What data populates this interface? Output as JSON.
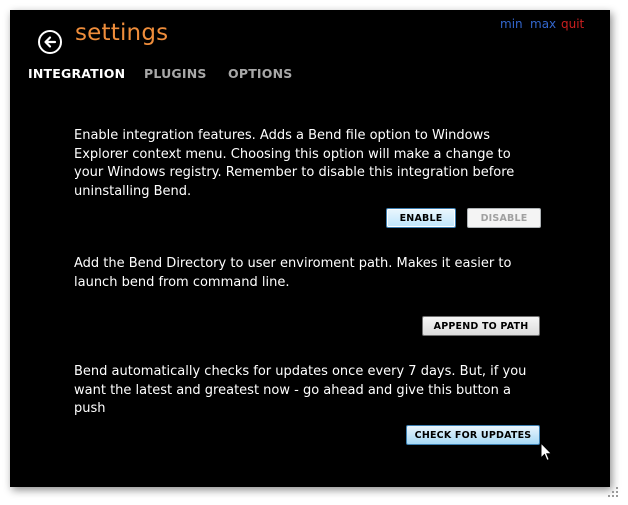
{
  "header": {
    "title": "settings",
    "back_icon": "back-arrow-icon"
  },
  "window_controls": {
    "min": "min",
    "max": "max",
    "quit": "quit"
  },
  "tabs": [
    {
      "label": "INTEGRATION",
      "active": true
    },
    {
      "label": "PLUGINS",
      "active": false
    },
    {
      "label": "OPTIONS",
      "active": false
    }
  ],
  "sections": {
    "integration": {
      "text": "Enable integration features. Adds a Bend file option to Windows Explorer context menu. Choosing this option will make a change to your Windows registry. Remember to disable this integration before uninstalling Bend.",
      "enable_label": "ENABLE",
      "disable_label": "DISABLE"
    },
    "path": {
      "text": "Add the Bend Directory to user enviroment path. Makes it easier to launch bend from command line.",
      "button_label": "APPEND TO PATH"
    },
    "updates": {
      "text": "Bend automatically checks for updates once every 7 days. But, if you want the latest and greatest now - go ahead and give this button a push",
      "button_label": "CHECK FOR UPDATES"
    }
  },
  "colors": {
    "background": "#000000",
    "title": "#ef8d3b",
    "min_max": "#3366cc",
    "quit": "#cc1f1f",
    "tab_active": "#ffffff",
    "tab_inactive": "#a8a8a8"
  },
  "icons": {
    "cursor": "mouse-pointer-icon",
    "resize": "resize-grip-icon"
  }
}
